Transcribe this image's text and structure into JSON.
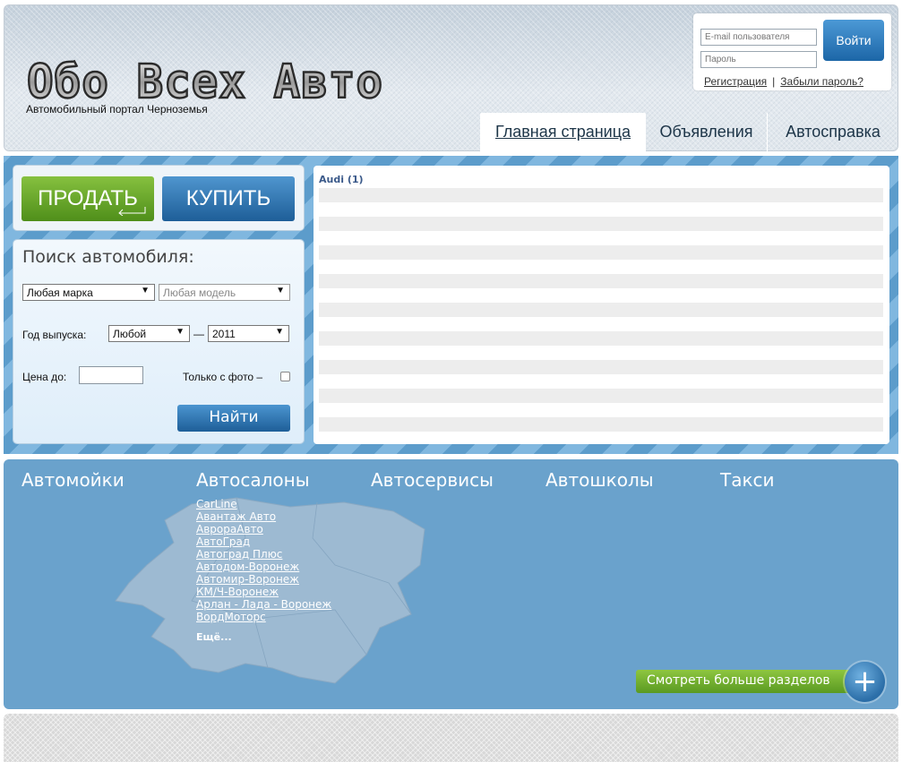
{
  "header": {
    "logo_text": "Обо Всех Авто",
    "tagline": "Автомобильный портал Черноземья"
  },
  "login": {
    "email_placeholder": "E-mail пользователя",
    "password_placeholder": "Пароль",
    "submit_label": "Войти",
    "register_link": "Регистрация",
    "separator": "|",
    "forgot_link": "Забыли пароль?"
  },
  "nav": {
    "tabs": [
      {
        "label": "Главная страница",
        "active": true
      },
      {
        "label": "Объявления",
        "active": false
      },
      {
        "label": "Автосправка",
        "active": false
      }
    ]
  },
  "actions": {
    "sell_label": "ПРОДАТЬ",
    "buy_label": "КУПИТЬ"
  },
  "search": {
    "title": "Поиск автомобиля:",
    "brand_value": "Любая марка",
    "model_value": "Любая модель",
    "year_label": "Год выпуска:",
    "year_from_value": "Любой",
    "year_dash": "—",
    "year_to_value": "2011",
    "price_label": "Цена до:",
    "price_value": "",
    "photo_only_label": "Только с фото –",
    "photo_only_checked": false,
    "submit_label": "Найти"
  },
  "results": {
    "heading": "Audi (1)"
  },
  "categories": {
    "titles": [
      "Автомойки",
      "Автосалоны",
      "Автосервисы",
      "Автошколы",
      "Такси"
    ],
    "salons": [
      "CarLine",
      "Авантаж Авто",
      "АврораАвто",
      "АвтоГрад",
      "Автоград Плюс",
      "Автодом-Воронеж",
      "Автомир-Воронеж",
      "КМ/Ч-Воронеж",
      "Арлан - Лада - Воронеж",
      "ВордМоторс"
    ],
    "more_label": "Ещё...",
    "more_sections_label": "Смотреть больше разделов",
    "plus_icon": "+"
  },
  "colors": {
    "accent_blue": "#1e5e98",
    "sell_green": "#4f8f1a",
    "section_blue": "#6aa2cc"
  }
}
